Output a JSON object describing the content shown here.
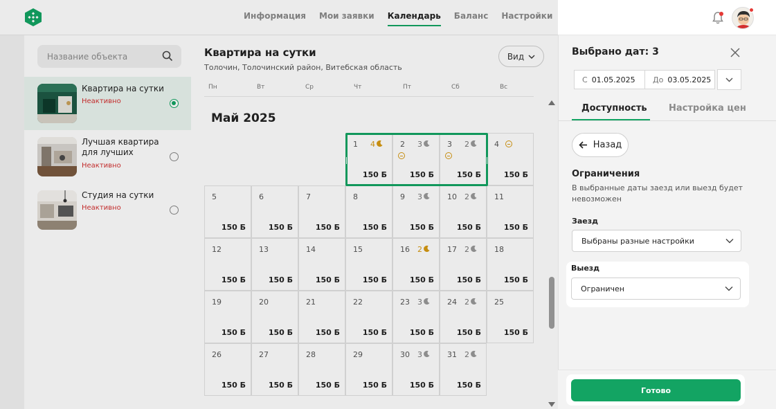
{
  "header": {
    "nav": [
      {
        "label": "Информация"
      },
      {
        "label": "Мои заявки"
      },
      {
        "label": "Календарь"
      },
      {
        "label": "Баланс"
      },
      {
        "label": "Настройки"
      }
    ],
    "active_nav": "Календарь",
    "accent": "#13a463"
  },
  "sidebar": {
    "search_placeholder": "Название объекта",
    "items": [
      {
        "title": "Квартира на сутки",
        "status": "Неактивно",
        "selected": true
      },
      {
        "title": "Лучшая квартира для лучших",
        "status": "Неактивно",
        "selected": false
      },
      {
        "title": "Студия на сутки",
        "status": "Неактивно",
        "selected": false
      }
    ]
  },
  "calendar": {
    "title": "Квартира на сутки",
    "address": "Толочин, Толочинский район, Витебская область",
    "view_label": "Вид",
    "weekdays": [
      "Пн",
      "Вт",
      "Ср",
      "Чт",
      "Пт",
      "Сб",
      "Вс"
    ],
    "month": "Май 2025",
    "days": [
      {
        "d": "1",
        "price": "150 Б",
        "nights": "4",
        "gold": true,
        "minus": false
      },
      {
        "d": "2",
        "price": "150 Б",
        "nights": "3",
        "gold": false,
        "minus": true
      },
      {
        "d": "3",
        "price": "150 Б",
        "nights": "2",
        "gold": false,
        "minus": true
      },
      {
        "d": "4",
        "price": "150 Б",
        "nights": "",
        "gold": false,
        "minus": true
      },
      {
        "d": "5",
        "price": "150 Б"
      },
      {
        "d": "6",
        "price": "150 Б"
      },
      {
        "d": "7",
        "price": "150 Б"
      },
      {
        "d": "8",
        "price": "150 Б"
      },
      {
        "d": "9",
        "price": "150 Б",
        "nights": "3"
      },
      {
        "d": "10",
        "price": "150 Б",
        "nights": "2"
      },
      {
        "d": "11",
        "price": "150 Б"
      },
      {
        "d": "12",
        "price": "150 Б"
      },
      {
        "d": "13",
        "price": "150 Б"
      },
      {
        "d": "14",
        "price": "150 Б"
      },
      {
        "d": "15",
        "price": "150 Б"
      },
      {
        "d": "16",
        "price": "150 Б",
        "nights": "2",
        "gold": true
      },
      {
        "d": "17",
        "price": "150 Б",
        "nights": "2"
      },
      {
        "d": "18",
        "price": "150 Б"
      },
      {
        "d": "19",
        "price": "150 Б"
      },
      {
        "d": "20",
        "price": "150 Б"
      },
      {
        "d": "21",
        "price": "150 Б"
      },
      {
        "d": "22",
        "price": "150 Б"
      },
      {
        "d": "23",
        "price": "150 Б",
        "nights": "3"
      },
      {
        "d": "24",
        "price": "150 Б",
        "nights": "2"
      },
      {
        "d": "25",
        "price": "150 Б"
      },
      {
        "d": "26",
        "price": "150 Б"
      },
      {
        "d": "27",
        "price": "150 Б"
      },
      {
        "d": "28",
        "price": "150 Б"
      },
      {
        "d": "29",
        "price": "150 Б"
      },
      {
        "d": "30",
        "price": "150 Б",
        "nights": "3"
      },
      {
        "d": "31",
        "price": "150 Б",
        "nights": "2"
      }
    ]
  },
  "panel": {
    "title": "Выбрано дат: 3",
    "from_label": "С",
    "from_value": "01.05.2025",
    "to_label": "До",
    "to_value": "03.05.2025",
    "tabs": [
      "Доступность",
      "Настройка цен"
    ],
    "back_label": "Назад",
    "restrictions_title": "Ограничения",
    "restrictions_desc": "В выбранные даты заезд или выезд будет невозможен",
    "checkin_label": "Заезд",
    "checkin_value": "Выбраны разные настройки",
    "checkout_label": "Выезд",
    "checkout_value": "Ограничен",
    "done_label": "Готово"
  }
}
